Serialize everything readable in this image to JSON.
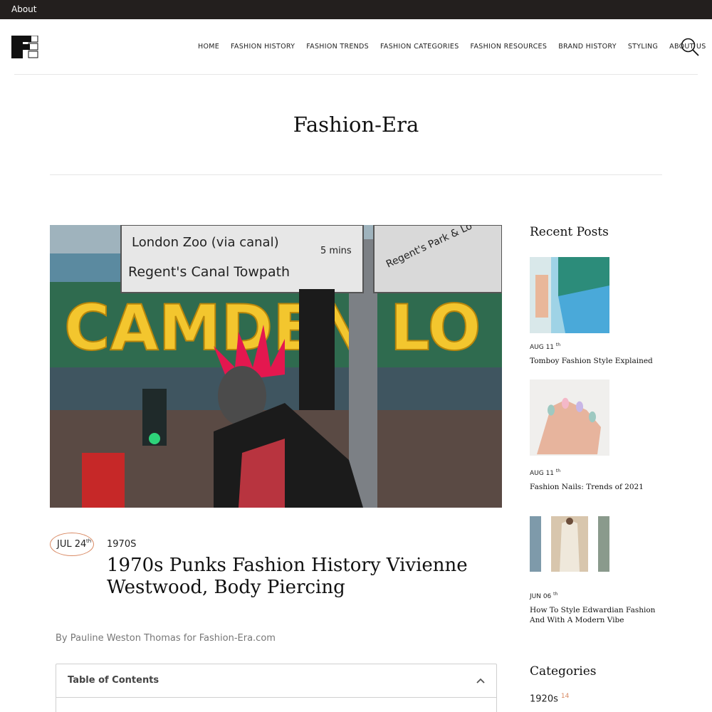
{
  "topbar": {
    "about_label": "About"
  },
  "header": {
    "logo_alt": "FE",
    "nav": [
      "HOME",
      "FASHION HISTORY",
      "FASHION TRENDS",
      "FASHION CATEGORIES",
      "FASHION RESOURCES",
      "BRAND HISTORY",
      "STYLING",
      "ABOUT US"
    ],
    "search_icon": "search-icon"
  },
  "site_title": "Fashion-Era",
  "post": {
    "date_month_day": "JUL 24",
    "date_suffix": "th",
    "category": "1970S",
    "title": "1970s Punks Fashion History Vivienne Westwood, Body Piercing",
    "byline": "By Pauline Weston Thomas for Fashion-Era.com",
    "hero_sign_1": "London Zoo (via canal)",
    "hero_sign_2": "Regent's Canal Towpath",
    "hero_sign_3": "Regent's Park & Lo",
    "hero_sign_4": "5 mins",
    "hero_bridge_text": "CAMDEN LO"
  },
  "toc": {
    "label": "Table of Contents"
  },
  "sidebar": {
    "recent_heading": "Recent Posts",
    "recent": [
      {
        "date": "AUG 11",
        "suffix": "th",
        "title": "Tomboy Fashion Style Explained"
      },
      {
        "date": "AUG 11",
        "suffix": "th",
        "title": "Fashion Nails: Trends of 2021"
      },
      {
        "date": "JUN 06",
        "suffix": "th",
        "title": "How To Style Edwardian Fashion And With A Modern Vibe"
      }
    ],
    "categories_heading": "Categories",
    "categories": [
      {
        "name": "1920s",
        "count": "14"
      }
    ]
  },
  "colors": {
    "topbar": "#231f1e",
    "accent": "#d98a64"
  }
}
